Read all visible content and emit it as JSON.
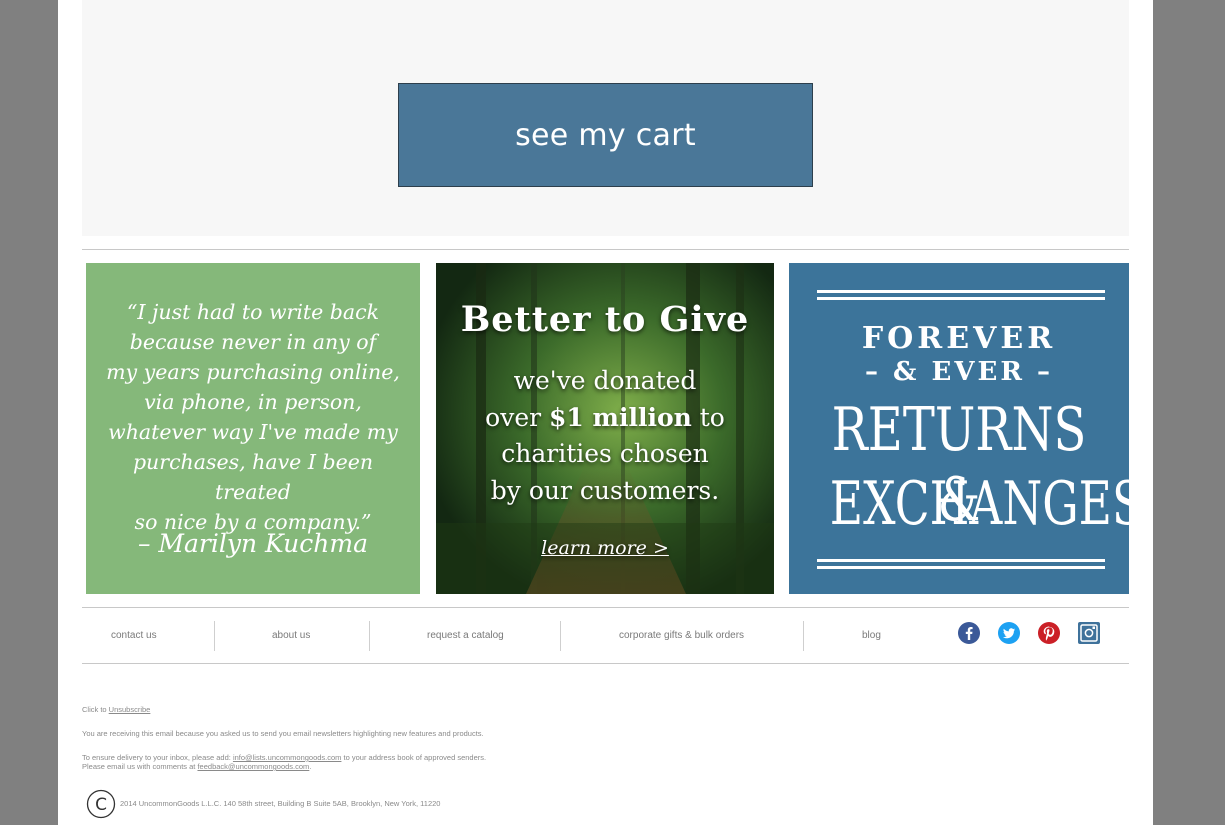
{
  "cart": {
    "button_label": "see my cart"
  },
  "promos": {
    "quote": {
      "lines": [
        "“I just had to write back",
        "because never in any of",
        "my years purchasing online,",
        "via phone, in person,",
        "whatever way I've made my",
        "purchases, have I been treated",
        "so nice by a company.”"
      ],
      "signature": "– Marilyn Kuchma"
    },
    "give": {
      "title": "Better to Give",
      "line1": "we've donated",
      "line2_pre": "over ",
      "line2_bold": "$1 million",
      "line2_post": " to",
      "line3": "charities chosen",
      "line4": "by our customers.",
      "link": "learn more >"
    },
    "returns": {
      "line1": "FOREVER",
      "line2": "– & EVER –",
      "line3": "RETURNS &",
      "line4": "EXCHANGES"
    }
  },
  "footer_nav": {
    "contact": "contact us",
    "about": "about us",
    "catalog": "request a catalog",
    "corporate": "corporate gifts & bulk orders",
    "blog": "blog"
  },
  "social": {
    "facebook_icon": "facebook-icon",
    "twitter_icon": "twitter-icon",
    "pinterest_icon": "pinterest-icon",
    "instagram_icon": "instagram-icon",
    "facebook_color": "#3b5998",
    "twitter_color": "#1da1f2",
    "pinterest_color": "#cb2027",
    "instagram_color": "#3f729b"
  },
  "legal": {
    "unsubscribe_prefix": "Click to ",
    "unsubscribe_link": "Unsubscribe",
    "reason": "You are receiving this email because you asked us to send you email newsletters highlighting new features and products.",
    "delivery_prefix": "To ensure delivery to your inbox, please add: ",
    "delivery_email": "info@lists.uncommongoods.com",
    "delivery_suffix": " to your address book of approved senders.",
    "comments_prefix": "Please email us with comments at ",
    "comments_email": "feedback@uncommongoods.com",
    "comments_suffix": "."
  },
  "copyright": {
    "symbol": "©",
    "text": "2014 UncommonGoods L.L.C. 140 58th street, Building B Suite 5AB, Brooklyn, New York, 11220"
  }
}
